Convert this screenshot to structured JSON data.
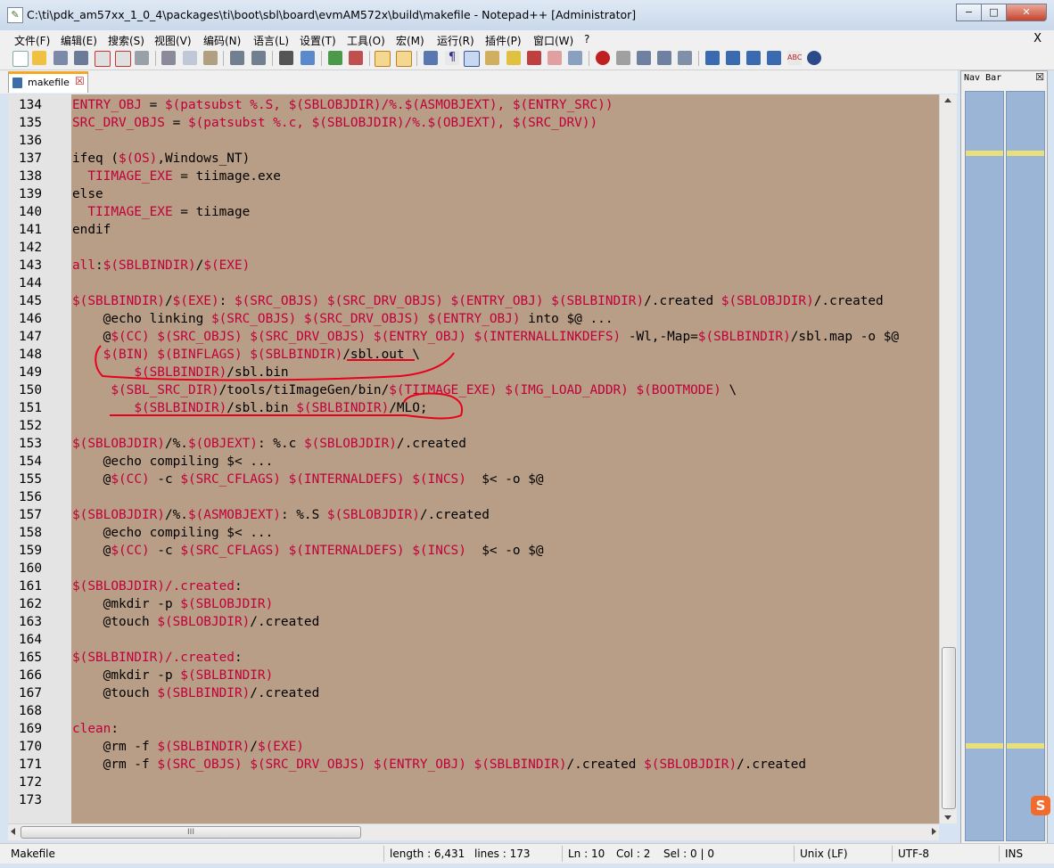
{
  "window": {
    "title": "C:\\ti\\pdk_am57xx_1_0_4\\packages\\ti\\boot\\sbl\\board\\evmAM572x\\build\\makefile - Notepad++ [Administrator]",
    "minimize": "−",
    "maximize": "□",
    "close": "✕"
  },
  "menu": {
    "items": [
      "文件(F)",
      "编辑(E)",
      "搜索(S)",
      "视图(V)",
      "编码(N)",
      "语言(L)",
      "设置(T)",
      "工具(O)",
      "宏(M)",
      "运行(R)",
      "插件(P)",
      "窗口(W)",
      "?"
    ],
    "close": "X"
  },
  "tab": {
    "label": "makefile",
    "close": "☒"
  },
  "navbar": {
    "title": "Nav Bar",
    "close": "☒"
  },
  "hscroll_thumb": "III",
  "editor": {
    "lines": [
      {
        "n": "134",
        "segs": [
          [
            "m",
            "ENTRY_OBJ"
          ],
          [
            "",
            "="
          ],
          [
            "m",
            "$(patsubst %.S, $(SBLOBJDIR)/%.$(ASMOBJEXT), $(ENTRY_SRC))"
          ]
        ]
      },
      {
        "n": "135",
        "segs": [
          [
            "m",
            "SRC_DRV_OBJS"
          ],
          [
            "",
            "="
          ],
          [
            "m",
            "$(patsubst %.c, $(SBLOBJDIR)/%.$(OBJEXT), $(SRC_DRV))"
          ]
        ]
      },
      {
        "n": "136",
        "segs": []
      },
      {
        "n": "137",
        "segs": [
          [
            "",
            "ifeq ("
          ],
          [
            "m",
            "$(OS)"
          ],
          [
            "",
            ",Windows_NT)"
          ]
        ]
      },
      {
        "n": "138",
        "segs": [
          [
            "",
            "  "
          ],
          [
            "m",
            "TIIMAGE_EXE"
          ],
          [
            "",
            " = tiimage.exe"
          ]
        ]
      },
      {
        "n": "139",
        "segs": [
          [
            "",
            "else"
          ]
        ]
      },
      {
        "n": "140",
        "segs": [
          [
            "",
            "  "
          ],
          [
            "m",
            "TIIMAGE_EXE"
          ],
          [
            "",
            " = tiimage"
          ]
        ]
      },
      {
        "n": "141",
        "segs": [
          [
            "",
            "endif"
          ]
        ]
      },
      {
        "n": "142",
        "segs": []
      },
      {
        "n": "143",
        "segs": [
          [
            "m",
            "all"
          ],
          [
            "",
            ":"
          ],
          [
            "m",
            "$(SBLBINDIR)"
          ],
          [
            "",
            "/"
          ],
          [
            "m",
            "$(EXE)"
          ]
        ]
      },
      {
        "n": "144",
        "segs": []
      },
      {
        "n": "145",
        "segs": [
          [
            "m",
            "$(SBLBINDIR)"
          ],
          [
            "",
            "/"
          ],
          [
            "m",
            "$(EXE)"
          ],
          [
            "",
            ": "
          ],
          [
            "m",
            "$(SRC_OBJS) $(SRC_DRV_OBJS) $(ENTRY_OBJ) $(SBLBINDIR)"
          ],
          [
            "",
            "/.created "
          ],
          [
            "m",
            "$(SBLOBJDIR)"
          ],
          [
            "",
            "/.created"
          ]
        ]
      },
      {
        "n": "146",
        "segs": [
          [
            "",
            "    @echo linking "
          ],
          [
            "m",
            "$(SRC_OBJS) $(SRC_DRV_OBJS) $(ENTRY_OBJ)"
          ],
          [
            "",
            " into $@ ..."
          ]
        ]
      },
      {
        "n": "147",
        "segs": [
          [
            "",
            "    @"
          ],
          [
            "m",
            "$(CC) $(SRC_OBJS) $(SRC_DRV_OBJS) $(ENTRY_OBJ) $(INTERNALLINKDEFS)"
          ],
          [
            "",
            " -Wl,-Map="
          ],
          [
            "m",
            "$(SBLBINDIR)"
          ],
          [
            "",
            "/sbl.map -o $@"
          ]
        ]
      },
      {
        "n": "148",
        "segs": [
          [
            "",
            "    "
          ],
          [
            "m",
            "$(BIN) $(BINFLAGS) $(SBLBINDIR)"
          ],
          [
            "",
            "/sbl.out \\"
          ]
        ]
      },
      {
        "n": "149",
        "segs": [
          [
            "",
            "        "
          ],
          [
            "m",
            "$(SBLBINDIR)"
          ],
          [
            "",
            "/sbl.bin"
          ]
        ]
      },
      {
        "n": "150",
        "segs": [
          [
            "",
            "     "
          ],
          [
            "m",
            "$(SBL_SRC_DIR)"
          ],
          [
            "",
            "/tools/tiImageGen/bin/"
          ],
          [
            "m",
            "$(TIIMAGE_EXE) $(IMG_LOAD_ADDR) $(BOOTMODE)"
          ],
          [
            "",
            " \\"
          ]
        ]
      },
      {
        "n": "151",
        "segs": [
          [
            "",
            "        "
          ],
          [
            "m",
            "$(SBLBINDIR)"
          ],
          [
            "",
            "/sbl.bin "
          ],
          [
            "m",
            "$(SBLBINDIR)"
          ],
          [
            "",
            "/MLO;"
          ]
        ]
      },
      {
        "n": "152",
        "segs": []
      },
      {
        "n": "153",
        "segs": [
          [
            "m",
            "$(SBLOBJDIR)"
          ],
          [
            "",
            "/%."
          ],
          [
            "m",
            "$(OBJEXT)"
          ],
          [
            "",
            ": %.c "
          ],
          [
            "m",
            "$(SBLOBJDIR)"
          ],
          [
            "",
            "/.created"
          ]
        ]
      },
      {
        "n": "154",
        "segs": [
          [
            "",
            "    @echo compiling $< ..."
          ]
        ]
      },
      {
        "n": "155",
        "segs": [
          [
            "",
            "    @"
          ],
          [
            "m",
            "$(CC)"
          ],
          [
            "",
            " -c "
          ],
          [
            "m",
            "$(SRC_CFLAGS) $(INTERNALDEFS) $(INCS)"
          ],
          [
            "",
            "  $< -o $@"
          ]
        ]
      },
      {
        "n": "156",
        "segs": []
      },
      {
        "n": "157",
        "segs": [
          [
            "m",
            "$(SBLOBJDIR)"
          ],
          [
            "",
            "/%."
          ],
          [
            "m",
            "$(ASMOBJEXT)"
          ],
          [
            "",
            ": %.S "
          ],
          [
            "m",
            "$(SBLOBJDIR)"
          ],
          [
            "",
            "/.created"
          ]
        ]
      },
      {
        "n": "158",
        "segs": [
          [
            "",
            "    @echo compiling $< ..."
          ]
        ]
      },
      {
        "n": "159",
        "segs": [
          [
            "",
            "    @"
          ],
          [
            "m",
            "$(CC)"
          ],
          [
            "",
            " -c "
          ],
          [
            "m",
            "$(SRC_CFLAGS) $(INTERNALDEFS) $(INCS)"
          ],
          [
            "",
            "  $< -o $@"
          ]
        ]
      },
      {
        "n": "160",
        "segs": []
      },
      {
        "n": "161",
        "segs": [
          [
            "m",
            "$(SBLOBJDIR)/.created"
          ],
          [
            "",
            ":"
          ]
        ]
      },
      {
        "n": "162",
        "segs": [
          [
            "",
            "    @mkdir -p "
          ],
          [
            "m",
            "$(SBLOBJDIR)"
          ]
        ]
      },
      {
        "n": "163",
        "segs": [
          [
            "",
            "    @touch "
          ],
          [
            "m",
            "$(SBLOBJDIR)"
          ],
          [
            "",
            "/.created"
          ]
        ]
      },
      {
        "n": "164",
        "segs": []
      },
      {
        "n": "165",
        "segs": [
          [
            "m",
            "$(SBLBINDIR)/.created"
          ],
          [
            "",
            ":"
          ]
        ]
      },
      {
        "n": "166",
        "segs": [
          [
            "",
            "    @mkdir -p "
          ],
          [
            "m",
            "$(SBLBINDIR)"
          ]
        ]
      },
      {
        "n": "167",
        "segs": [
          [
            "",
            "    @touch "
          ],
          [
            "m",
            "$(SBLBINDIR)"
          ],
          [
            "",
            "/.created"
          ]
        ]
      },
      {
        "n": "168",
        "segs": []
      },
      {
        "n": "169",
        "segs": [
          [
            "m",
            "clean"
          ],
          [
            "",
            ":"
          ]
        ]
      },
      {
        "n": "170",
        "segs": [
          [
            "",
            "    @rm -f "
          ],
          [
            "m",
            "$(SBLBINDIR)"
          ],
          [
            "",
            "/"
          ],
          [
            "m",
            "$(EXE)"
          ]
        ]
      },
      {
        "n": "171",
        "segs": [
          [
            "",
            "    @rm -f "
          ],
          [
            "m",
            "$(SRC_OBJS) $(SRC_DRV_OBJS) $(ENTRY_OBJ) $(SBLBINDIR)"
          ],
          [
            "",
            "/.created "
          ],
          [
            "m",
            "$(SBLOBJDIR)"
          ],
          [
            "",
            "/.created"
          ]
        ]
      },
      {
        "n": "172",
        "segs": []
      },
      {
        "n": "173",
        "segs": []
      }
    ]
  },
  "status": {
    "filetype": "Makefile",
    "length": "length : 6,431",
    "lines": "lines : 173",
    "ln": "Ln : 10",
    "col": "Col : 2",
    "sel": "Sel : 0 | 0",
    "eol": "Unix (LF)",
    "encoding": "UTF-8",
    "mode": "INS"
  },
  "colors": {
    "editor_bg": "#b89e86",
    "macro": "#c0003a",
    "annotation": "#e8001c",
    "navbar_col": "#9bb5d6"
  }
}
